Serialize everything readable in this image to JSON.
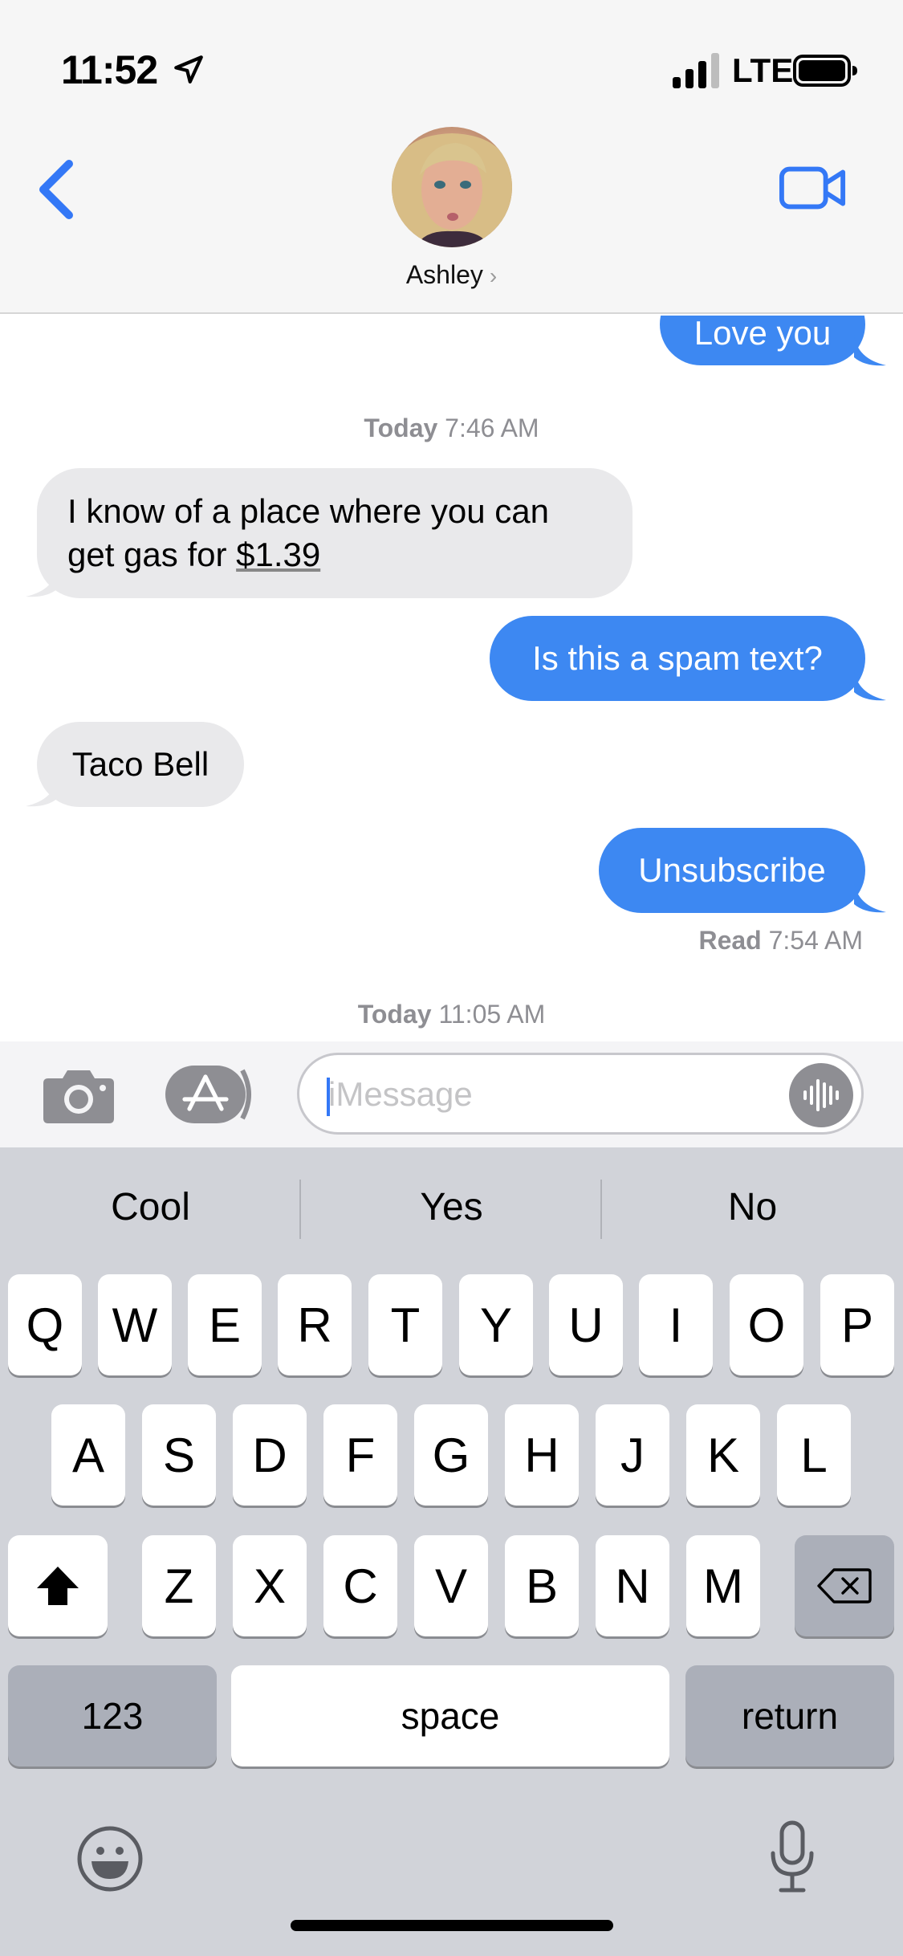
{
  "status_bar": {
    "time": "11:52",
    "network": "LTE"
  },
  "header": {
    "contact_name": "Ashley",
    "chevron": "›"
  },
  "messages": {
    "m0": {
      "text": "Love you"
    },
    "stamp1": {
      "day": "Today",
      "time": "7:46 AM"
    },
    "m1": {
      "line1": "I know of a place where you can",
      "line2_prefix": "get gas for ",
      "line2_link": "$1.39"
    },
    "m2": {
      "text": "Is this a spam text?"
    },
    "m3": {
      "text": "Taco Bell"
    },
    "m4": {
      "text": "Unsubscribe"
    },
    "read": {
      "label": "Read",
      "time": "7:54 AM"
    },
    "stamp2": {
      "day": "Today",
      "time": "11:05 AM"
    }
  },
  "input": {
    "placeholder": "iMessage",
    "value": ""
  },
  "keyboard": {
    "suggestions": [
      "Cool",
      "Yes",
      "No"
    ],
    "row1": [
      "Q",
      "W",
      "E",
      "R",
      "T",
      "Y",
      "U",
      "I",
      "O",
      "P"
    ],
    "row2": [
      "A",
      "S",
      "D",
      "F",
      "G",
      "H",
      "J",
      "K",
      "L"
    ],
    "row3": [
      "Z",
      "X",
      "C",
      "V",
      "B",
      "N",
      "M"
    ],
    "numbers_label": "123",
    "space_label": "space",
    "return_label": "return"
  },
  "icons": {
    "location": "location-arrow-icon",
    "signal": "cellular-signal-icon",
    "battery": "battery-icon",
    "back": "chevron-left-icon",
    "facetime": "video-camera-icon",
    "camera": "camera-icon",
    "apps": "app-store-icon",
    "audio": "audio-waveform-icon",
    "shift": "shift-arrow-icon",
    "delete": "backspace-icon",
    "emoji": "emoji-icon",
    "dictation": "microphone-icon"
  },
  "colors": {
    "accent": "#3478f6",
    "outgoing_bubble": "#3d88f2",
    "incoming_bubble": "#e9e9eb",
    "keyboard_bg": "#d1d3d9"
  }
}
